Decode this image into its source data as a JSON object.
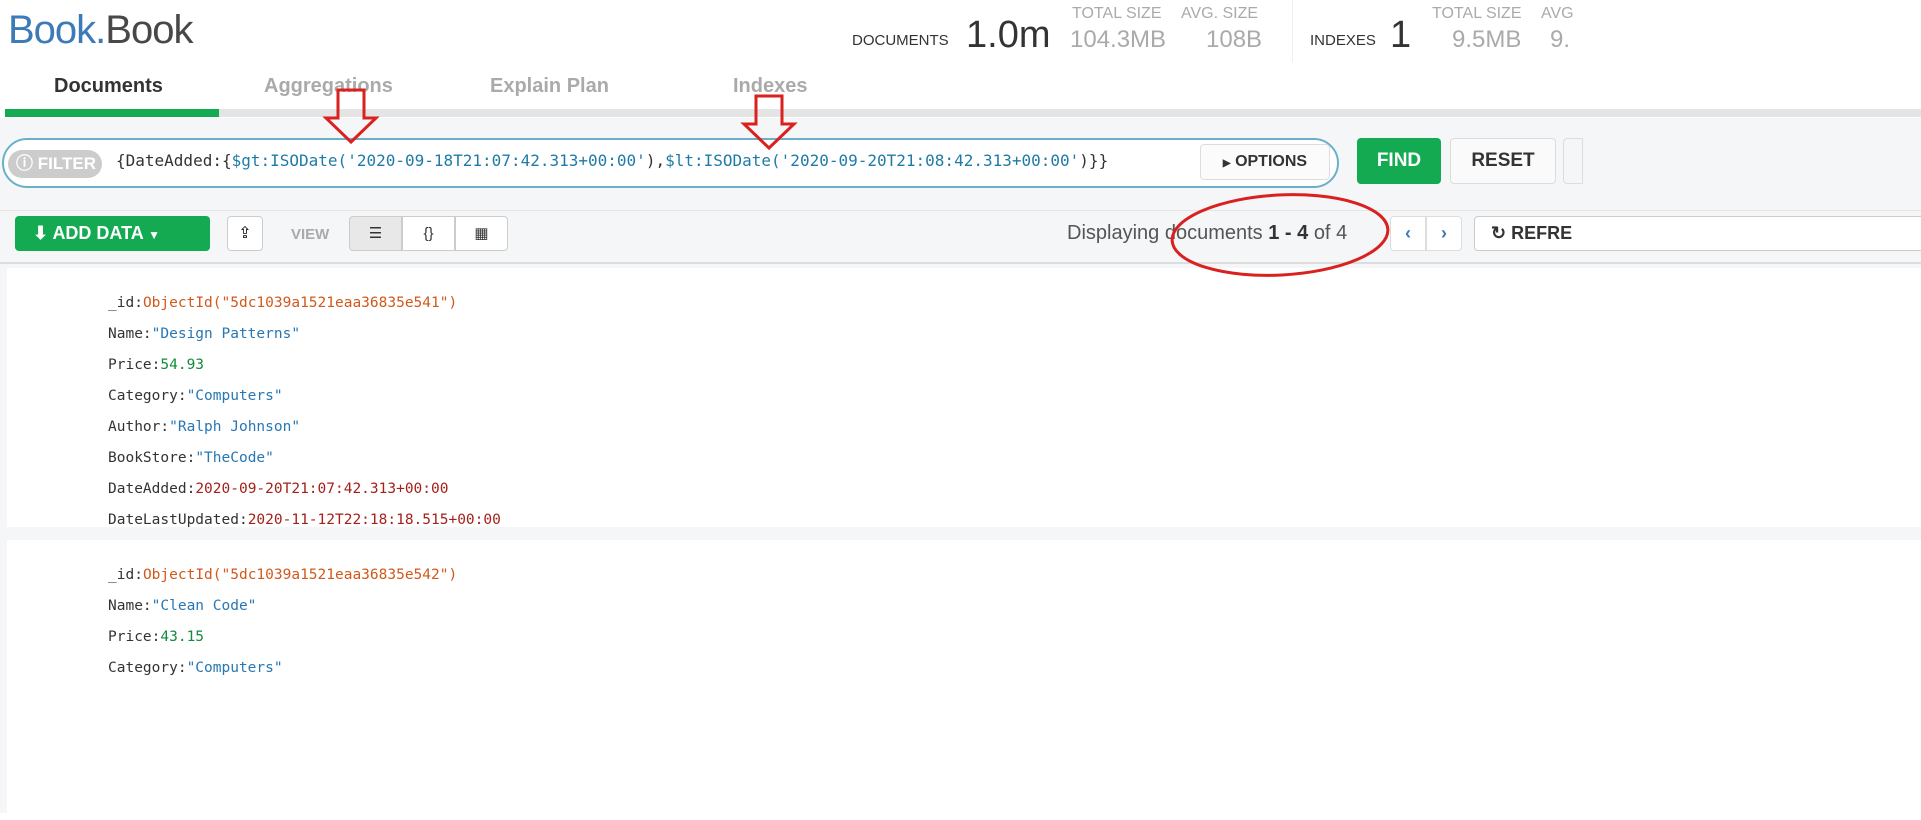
{
  "header": {
    "db": "Book",
    "dot": ".",
    "collection": "Book",
    "documents_label": "DOCUMENTS",
    "documents_count": "1.0m",
    "doc_total_size_label": "TOTAL SIZE",
    "doc_total_size": "104.3MB",
    "doc_avg_size_label": "AVG. SIZE",
    "doc_avg_size": "108B",
    "indexes_label": "INDEXES",
    "indexes_count": "1",
    "idx_total_size_label": "TOTAL SIZE",
    "idx_total_size": "9.5MB",
    "idx_avg_size_label": "AVG",
    "idx_avg_size": "9."
  },
  "tabs": [
    {
      "label": "Documents",
      "active": true
    },
    {
      "label": "Aggregations"
    },
    {
      "label": "Explain Plan"
    },
    {
      "label": "Indexes"
    }
  ],
  "filter": {
    "label": "FILTER",
    "q1": "{DateAdded:{",
    "q2": "$gt:ISODate(",
    "q3": "'2020-09-18T21:07:42.313+00:00'",
    "q4": "),",
    "q5": "$lt:ISODate(",
    "q6": "'2020-09-20T21:08:42.313+00:00'",
    "q7": ")}}",
    "options_label": "OPTIONS",
    "find_label": "FIND",
    "reset_label": "RESET"
  },
  "toolbar": {
    "add_data_label": "ADD DATA",
    "view_label": "VIEW",
    "displaying": "Displaying documents",
    "range": "1 - 4",
    "of": "of",
    "total": "4",
    "refresh_label": "REFRE"
  },
  "documents": [
    {
      "fields": [
        [
          "_id",
          "ObjectId(\"5dc1039a1521eaa36835e541\")",
          "oid"
        ],
        [
          "Name",
          "\"Design Patterns\"",
          "str"
        ],
        [
          "Price",
          "54.93",
          "num"
        ],
        [
          "Category",
          "\"Computers\"",
          "str"
        ],
        [
          "Author",
          "\"Ralph Johnson\"",
          "str"
        ],
        [
          "BookStore",
          "\"TheCode\"",
          "str"
        ],
        [
          "DateAdded",
          "2020-09-20T21:07:42.313+00:00",
          "date"
        ],
        [
          "DateLastUpdated",
          "2020-11-12T22:18:18.515+00:00",
          "date"
        ]
      ]
    },
    {
      "fields": [
        [
          "_id",
          "ObjectId(\"5dc1039a1521eaa36835e542\")",
          "oid"
        ],
        [
          "Name",
          "\"Clean Code\"",
          "str"
        ],
        [
          "Price",
          "43.15",
          "num"
        ],
        [
          "Category",
          "\"Computers\"",
          "str"
        ]
      ]
    }
  ],
  "colors": {
    "accent": "#13aa52",
    "annotation": "#d9211f",
    "link": "#3d7ab8"
  }
}
